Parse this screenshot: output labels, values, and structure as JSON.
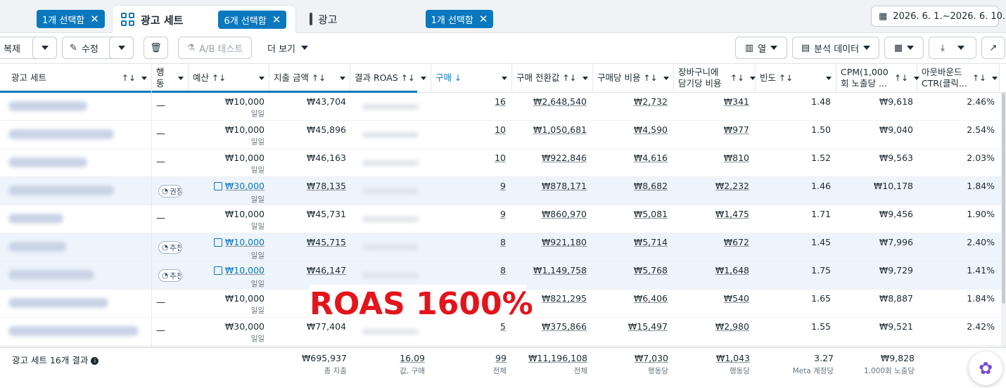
{
  "tabs": {
    "tab1": {
      "chip": "1개 선택함"
    },
    "tab2": {
      "label": "광고 세트",
      "chip": "6개 선택함"
    },
    "tab3": {
      "label": "광고",
      "chip": "1개 선택함"
    },
    "close_glyph": "✕",
    "date_range": "2026. 6. 1.~2026. 6. 10."
  },
  "toolbar": {
    "duplicate": "복제",
    "edit": "수정",
    "ab_test": "A/B 테스트",
    "more": "더 보기",
    "columns": "열",
    "breakdown": "분석 데이터"
  },
  "columns": [
    {
      "key": "adset",
      "label": "광고 세트",
      "sort": "↑↓"
    },
    {
      "key": "delivery",
      "label": "행동",
      "sort": ""
    },
    {
      "key": "budget",
      "label": "예산",
      "sort": "↑↓"
    },
    {
      "key": "spend",
      "label": "지출 금액",
      "sort": "↑↓"
    },
    {
      "key": "roas",
      "label": "결과 ROAS",
      "sort": "↑↓"
    },
    {
      "key": "purchases",
      "label": "구매",
      "sort": "↓"
    },
    {
      "key": "conv_value",
      "label": "구매 전환값",
      "sort": "↑↓"
    },
    {
      "key": "cpp",
      "label": "구매당 비용",
      "sort": "↑↓"
    },
    {
      "key": "cart_cost",
      "label": "장바구니에 담기당 비용",
      "sort": "↑↓"
    },
    {
      "key": "freq",
      "label": "빈도",
      "sort": "↑↓"
    },
    {
      "key": "cpm",
      "label": "CPM(1,000회 노출당 ...",
      "sort": "↑↓"
    },
    {
      "key": "ctr",
      "label": "아웃바운드 CTR(클릭...",
      "sort": "↑↓"
    }
  ],
  "rows": [
    {
      "delivery": "—",
      "budget": "₩10,000",
      "budget_sub": "일일",
      "budget_link": false,
      "spend": "₩43,704",
      "purchases": "16",
      "conv_value": "₩2,648,540",
      "cpp": "₩2,732",
      "cart_cost": "₩341",
      "freq": "1.48",
      "cpm": "₩9,618",
      "ctr": "2.46%",
      "hl": false
    },
    {
      "delivery": "—",
      "budget": "₩10,000",
      "budget_sub": "일일",
      "budget_link": false,
      "spend": "₩45,896",
      "purchases": "10",
      "conv_value": "₩1,050,681",
      "cpp": "₩4,590",
      "cart_cost": "₩977",
      "freq": "1.50",
      "cpm": "₩9,040",
      "ctr": "2.54%",
      "hl": false
    },
    {
      "delivery": "—",
      "budget": "₩10,000",
      "budget_sub": "일일",
      "budget_link": false,
      "spend": "₩46,163",
      "purchases": "10",
      "conv_value": "₩922,846",
      "cpp": "₩4,616",
      "cart_cost": "₩810",
      "freq": "1.52",
      "cpm": "₩9,563",
      "ctr": "2.03%",
      "hl": false
    },
    {
      "delivery": "권장",
      "budget": "₩30,000",
      "budget_sub": "일일",
      "budget_link": true,
      "spend": "₩78,135",
      "purchases": "9",
      "conv_value": "₩878,171",
      "cpp": "₩8,682",
      "cart_cost": "₩2,232",
      "freq": "1.46",
      "cpm": "₩10,178",
      "ctr": "1.84%",
      "hl": true
    },
    {
      "delivery": "—",
      "budget": "₩10,000",
      "budget_sub": "일일",
      "budget_link": false,
      "spend": "₩45,731",
      "purchases": "9",
      "conv_value": "₩860,970",
      "cpp": "₩5,081",
      "cart_cost": "₩1,475",
      "freq": "1.71",
      "cpm": "₩9,456",
      "ctr": "1.90%",
      "hl": false
    },
    {
      "delivery": "추천",
      "budget": "₩10,000",
      "budget_sub": "일일",
      "budget_link": true,
      "spend": "₩45,715",
      "purchases": "8",
      "conv_value": "₩921,180",
      "cpp": "₩5,714",
      "cart_cost": "₩672",
      "freq": "1.45",
      "cpm": "₩7,996",
      "ctr": "2.40%",
      "hl": true
    },
    {
      "delivery": "추천",
      "budget": "₩10,000",
      "budget_sub": "일일",
      "budget_link": true,
      "spend": "₩46,147",
      "purchases": "8",
      "conv_value": "₩1,149,758",
      "cpp": "₩5,768",
      "cart_cost": "₩1,648",
      "freq": "1.75",
      "cpm": "₩9,729",
      "ctr": "1.41%",
      "hl": true
    },
    {
      "delivery": "—",
      "budget": "₩10,000",
      "budget_sub": "일일",
      "budget_link": false,
      "spend": "",
      "purchases": "",
      "conv_value": "₩821,295",
      "cpp": "₩6,406",
      "cart_cost": "₩540",
      "freq": "1.65",
      "cpm": "₩8,887",
      "ctr": "1.84%",
      "hl": false
    },
    {
      "delivery": "—",
      "budget": "₩30,000",
      "budget_sub": "일일",
      "budget_link": false,
      "spend": "₩77,404",
      "purchases": "5",
      "conv_value": "₩375,866",
      "cpp": "₩15,497",
      "cart_cost": "₩2,980",
      "freq": "1.55",
      "cpm": "₩9,521",
      "ctr": "2.42%",
      "hl": false
    }
  ],
  "footer": {
    "label": "광고 세트 16개 결과",
    "info": "i",
    "spend": "₩695,937",
    "spend_sub": "총 지출",
    "roas": "16.09",
    "roas_sub": "값, 구매",
    "purchases": "99",
    "purchases_sub": "전체",
    "conv_value": "₩11,196,108",
    "conv_value_sub": "전체",
    "cpp": "₩7,030",
    "cpp_sub": "행동당",
    "cart_cost": "₩1,043",
    "cart_cost_sub": "행동당",
    "freq": "3.27",
    "freq_sub": "Meta 계정당",
    "cpm": "₩9,828",
    "cpm_sub": "1,000회 노출당"
  },
  "overlay": {
    "text": "ROAS 1600%",
    "color": "#e4141b"
  },
  "accent": "#0a78be"
}
